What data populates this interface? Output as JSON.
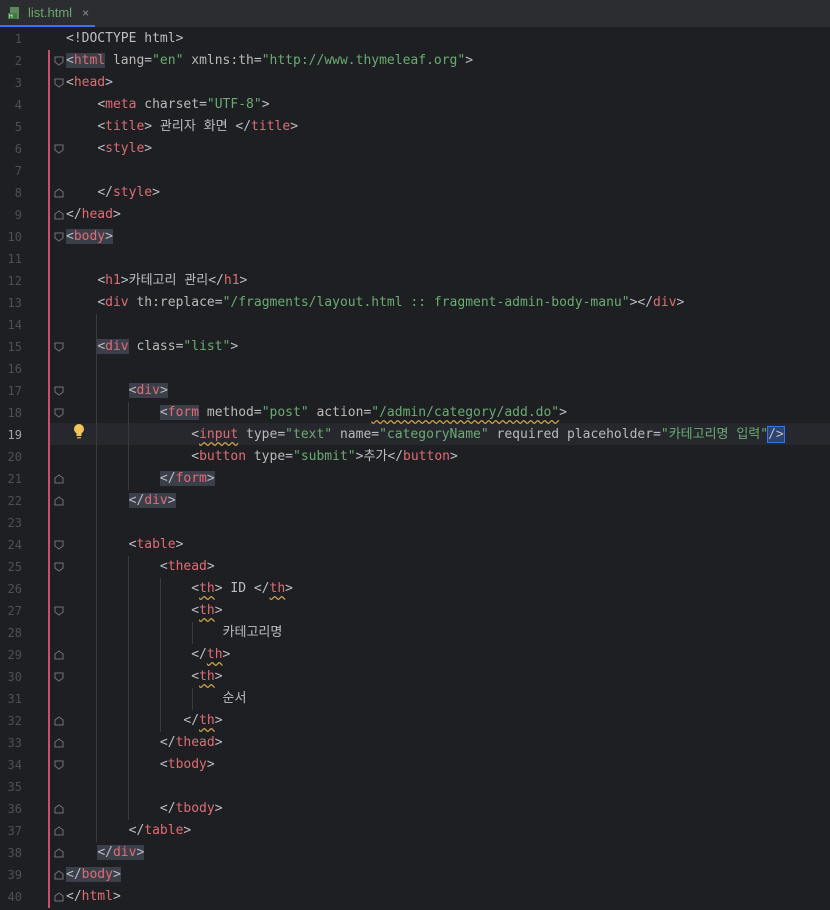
{
  "tab": {
    "filename": "list.html",
    "close": "×"
  },
  "editor": {
    "current_line": 19,
    "lines": [
      "1",
      "2",
      "3",
      "4",
      "5",
      "6",
      "7",
      "8",
      "9",
      "10",
      "11",
      "12",
      "13",
      "14",
      "15",
      "16",
      "17",
      "18",
      "19",
      "20",
      "21",
      "22",
      "23",
      "24",
      "25",
      "26",
      "27",
      "28",
      "29",
      "30",
      "31",
      "32",
      "33",
      "34",
      "35",
      "36",
      "37",
      "38",
      "39",
      "40"
    ]
  },
  "code": {
    "l1_doctype": "<!DOCTYPE html>",
    "l2_html_lang": "\"en\"",
    "l2_xmlns_val": "\"http://www.thymeleaf.org\"",
    "l4_charset": "\"UTF-8\"",
    "l5_title_text": " 관리자 화면 ",
    "l12_h1_text": "카테고리 관리",
    "l13_replace_val": "\"/fragments/layout.html :: fragment-admin-body-manu\"",
    "l15_class_val": "\"list\"",
    "l18_method_val": "\"post\"",
    "l18_action_val": "\"/admin/category/add.do\"",
    "l19_type_val": "\"text\"",
    "l19_name_val": "\"categoryName\"",
    "l19_placeholder_val": "\"카테고리명 입력\"",
    "l20_type_val": "\"submit\"",
    "l20_text": "추가",
    "l26_text": " ID ",
    "l28_text": "카테고리명",
    "l31_text": "순서"
  }
}
